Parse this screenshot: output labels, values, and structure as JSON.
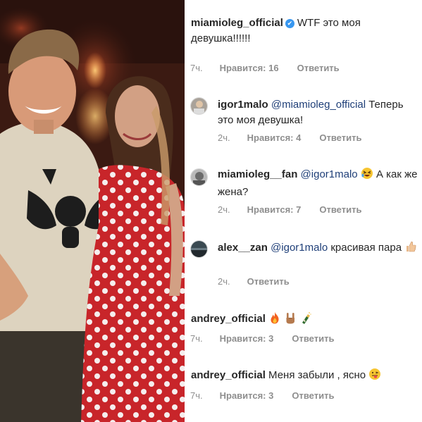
{
  "comments": [
    {
      "username": "miamioleg_official",
      "text": "WTF это моя девушка!!!!!!",
      "time": "7ч.",
      "likes": "Нравится: 16",
      "reply": "Ответить"
    },
    {
      "username": "igor1malo",
      "mention": "@miamioleg_official",
      "text": "Теперь это моя девушка!",
      "time": "2ч.",
      "likes": "Нравится: 4",
      "reply": "Ответить"
    },
    {
      "username": "miamioleg__fan",
      "mention": "@igor1malo",
      "text_after": "А как же жена?",
      "time": "2ч.",
      "likes": "Нравится: 7",
      "reply": "Ответить"
    },
    {
      "username": "alex__zan",
      "mention": "@igor1malo",
      "text": "красивая пара",
      "time": "2ч.",
      "reply": "Ответить"
    },
    {
      "username": "andrey_official",
      "time": "7ч.",
      "likes": "Нравится: 3",
      "reply": "Ответить"
    },
    {
      "username": "andrey_official",
      "text": "Меня забыли , ясно",
      "time": "7ч.",
      "likes": "Нравится: 3",
      "reply": "Ответить"
    }
  ],
  "icons": {
    "verified": "verified-badge-icon",
    "laughing": "rofl-emoji-icon",
    "thumbs_up": "thumbs-up-emoji-icon",
    "fire": "fire-emoji-icon",
    "rock_hand": "rock-hand-emoji-icon",
    "champagne": "champagne-emoji-icon",
    "tongue": "tongue-emoji-icon"
  },
  "colors": {
    "text": "#262626",
    "meta": "#8e8e8e",
    "mention": "#1f3f78",
    "verified": "#3897f0",
    "dress_red": "#c8252a"
  }
}
